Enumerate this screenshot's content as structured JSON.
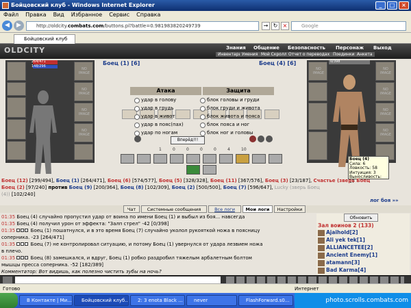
{
  "window": {
    "title": "Бойцовский клуб - Windows Internet Explorer"
  },
  "menu": [
    "Файл",
    "Правка",
    "Вид",
    "Избранное",
    "Сервис",
    "Справка"
  ],
  "address": {
    "prefix": "http://oldcity.",
    "domain": "combats.com",
    "path": "/buttons.pl?battle=0.981983820249739"
  },
  "search": {
    "placeholder": "Google"
  },
  "tab": {
    "label": "Бойцовский клуб"
  },
  "logo": "OLDCITY",
  "topnav": {
    "row1": [
      "Знания",
      "Общение",
      "Безопасность",
      "Персонаж",
      "Выход"
    ],
    "row2": [
      "Инвентарь",
      "Умения",
      "Мой Скроллл",
      "Отчет о переводах",
      "Поединки",
      "Анкета"
    ]
  },
  "player_left": {
    "name": "Боец (1)",
    "level": "[6]",
    "hp": "264/471",
    "mp": "148/296"
  },
  "player_right": {
    "name": "Боец (4)",
    "level": "[6]",
    "hp": "0/398"
  },
  "noimage": "NO IMAGE",
  "attack": {
    "header": "Атака",
    "options": [
      "удар в голову",
      "удар в грудь",
      "удар в живот",
      "удар в пояс(пах)",
      "удар по ногам"
    ]
  },
  "defense": {
    "header": "Защита",
    "options": [
      "блок головы и груди",
      "блок груди и живота",
      "блок живота и пояса",
      "блок пояса и ног",
      "блок ног и головы"
    ]
  },
  "forward_button": "Вперёд!!!",
  "counters": [
    "1",
    "0",
    "0",
    "0",
    "0",
    "4",
    "10"
  ],
  "tooltip": {
    "name": "Боец (4)",
    "lines": [
      "Сила: 6",
      "Ловкость: 58",
      "Интуиция: 3",
      "Выносливость: 17"
    ]
  },
  "teams": {
    "line1": [
      {
        "name": "Боец (12)",
        "hp": "[299/494]"
      },
      {
        "name": "Боец (1)",
        "hp": "[264/471]"
      },
      {
        "name": "Боец (6)",
        "hp": "[574/577]"
      },
      {
        "name": "Боец (5)",
        "hp": "[328/328]"
      },
      {
        "name": "Боец (11)",
        "hp": "[367/576]"
      },
      {
        "name": "Боец (3)",
        "hp": "[23/187]"
      },
      {
        "name": "Счастье (зверь Боец"
      }
    ],
    "line2a": [
      {
        "name": "Боец (2)",
        "hp": "[97/240]"
      }
    ],
    "vs": "против",
    "line2b": [
      {
        "name": "Боец (9)",
        "hp": "[200/364]"
      },
      {
        "name": "Боец (8)",
        "hp": "[102/309]"
      },
      {
        "name": "Боец (2)",
        "hp": "[500/500]"
      },
      {
        "name": "Боец (7)",
        "hp": "[596/647]"
      },
      {
        "name": "Lucky (зверь Боец"
      }
    ],
    "line3": [
      {
        "name": "(4))",
        "hp": "[102/240]"
      }
    ]
  },
  "log_footer": "лог боя »»",
  "log_tabs": [
    "Чат",
    "Системные сообщения",
    "Все логи",
    "Мои логи",
    "Настройки"
  ],
  "chat": [
    {
      "time": "01:35",
      "text": "Боец (4) случайно пропустил удар от воина по имени Боец (1) и выбыл из боя... навсегда"
    },
    {
      "time": "01:35",
      "text": "Боец (4) получил урон от эффекта: \"Залп стрел\" -42 [0/398]"
    },
    {
      "time": "01:35",
      "text": "Боец (1) пошатнулся, и в это время Боец (7) случайно уколол рукояткой ножа в поясницу"
    },
    {
      "time": "",
      "text": "соперника. -23 [264/471]"
    },
    {
      "time": "01:35",
      "text": "Боец (7) не контролировал ситуацию, и потому Боец (1) увернулся от удара лезвием ножа"
    },
    {
      "time": "",
      "text": "в плечо."
    },
    {
      "time": "01:35",
      "text": "Боец (8) замешкался, и вдруг, Боец (1) робко раздробил тяжелым арбалетным болтом"
    },
    {
      "time": "",
      "text": "мышцы пресса соперника. -52 [182/389]"
    },
    {
      "time": "",
      "text": "Комментатор: Вот видишь, как полезно чистить зубы на ночь?"
    }
  ],
  "sidebar": {
    "refresh": "Обновить",
    "header": "Зал воинов 2 (133)",
    "players": [
      "Ajaihold[2]",
      "Ali yek tek[1]",
      "ALLIANCETEE[2]",
      "Ancient Enemy[1]",
      "atamann[3]",
      "Bad Karma[4]"
    ]
  },
  "status": {
    "left": "Готово",
    "zone": "Интернет"
  },
  "taskbar": {
    "items": [
      "В Контакте | Ми...",
      "Бойцовский клуб...",
      "2: 3 enota Black ...",
      "never",
      "FlashForward.s0..."
    ],
    "watermark": "photo.scrolls.combats.com"
  }
}
